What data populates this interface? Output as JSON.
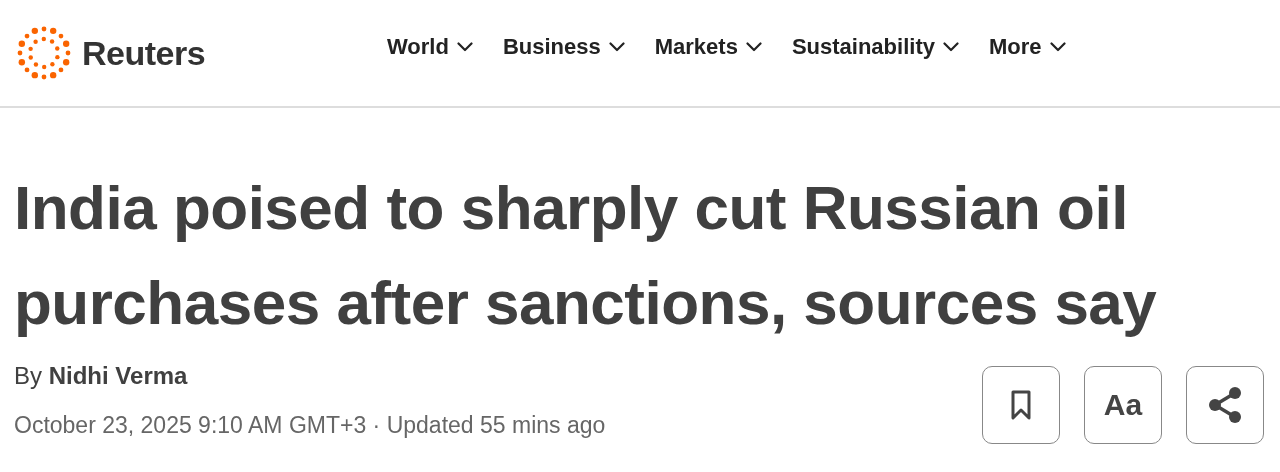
{
  "header": {
    "brand": "Reuters",
    "nav": [
      {
        "label": "World"
      },
      {
        "label": "Business"
      },
      {
        "label": "Markets"
      },
      {
        "label": "Sustainability"
      },
      {
        "label": "More"
      }
    ]
  },
  "article": {
    "headline": "India poised to sharply cut Russian oil purchases after sanctions, sources say",
    "byline": "By **Nidhi Verma**",
    "dateline": "October 23, 2025 9:10 AM GMT+3 · Updated 55 mins ago",
    "actions": [
      {
        "kind": "bookmark"
      },
      {
        "kind": "text",
        "label": "Aa"
      },
      {
        "kind": "share"
      }
    ]
  }
}
